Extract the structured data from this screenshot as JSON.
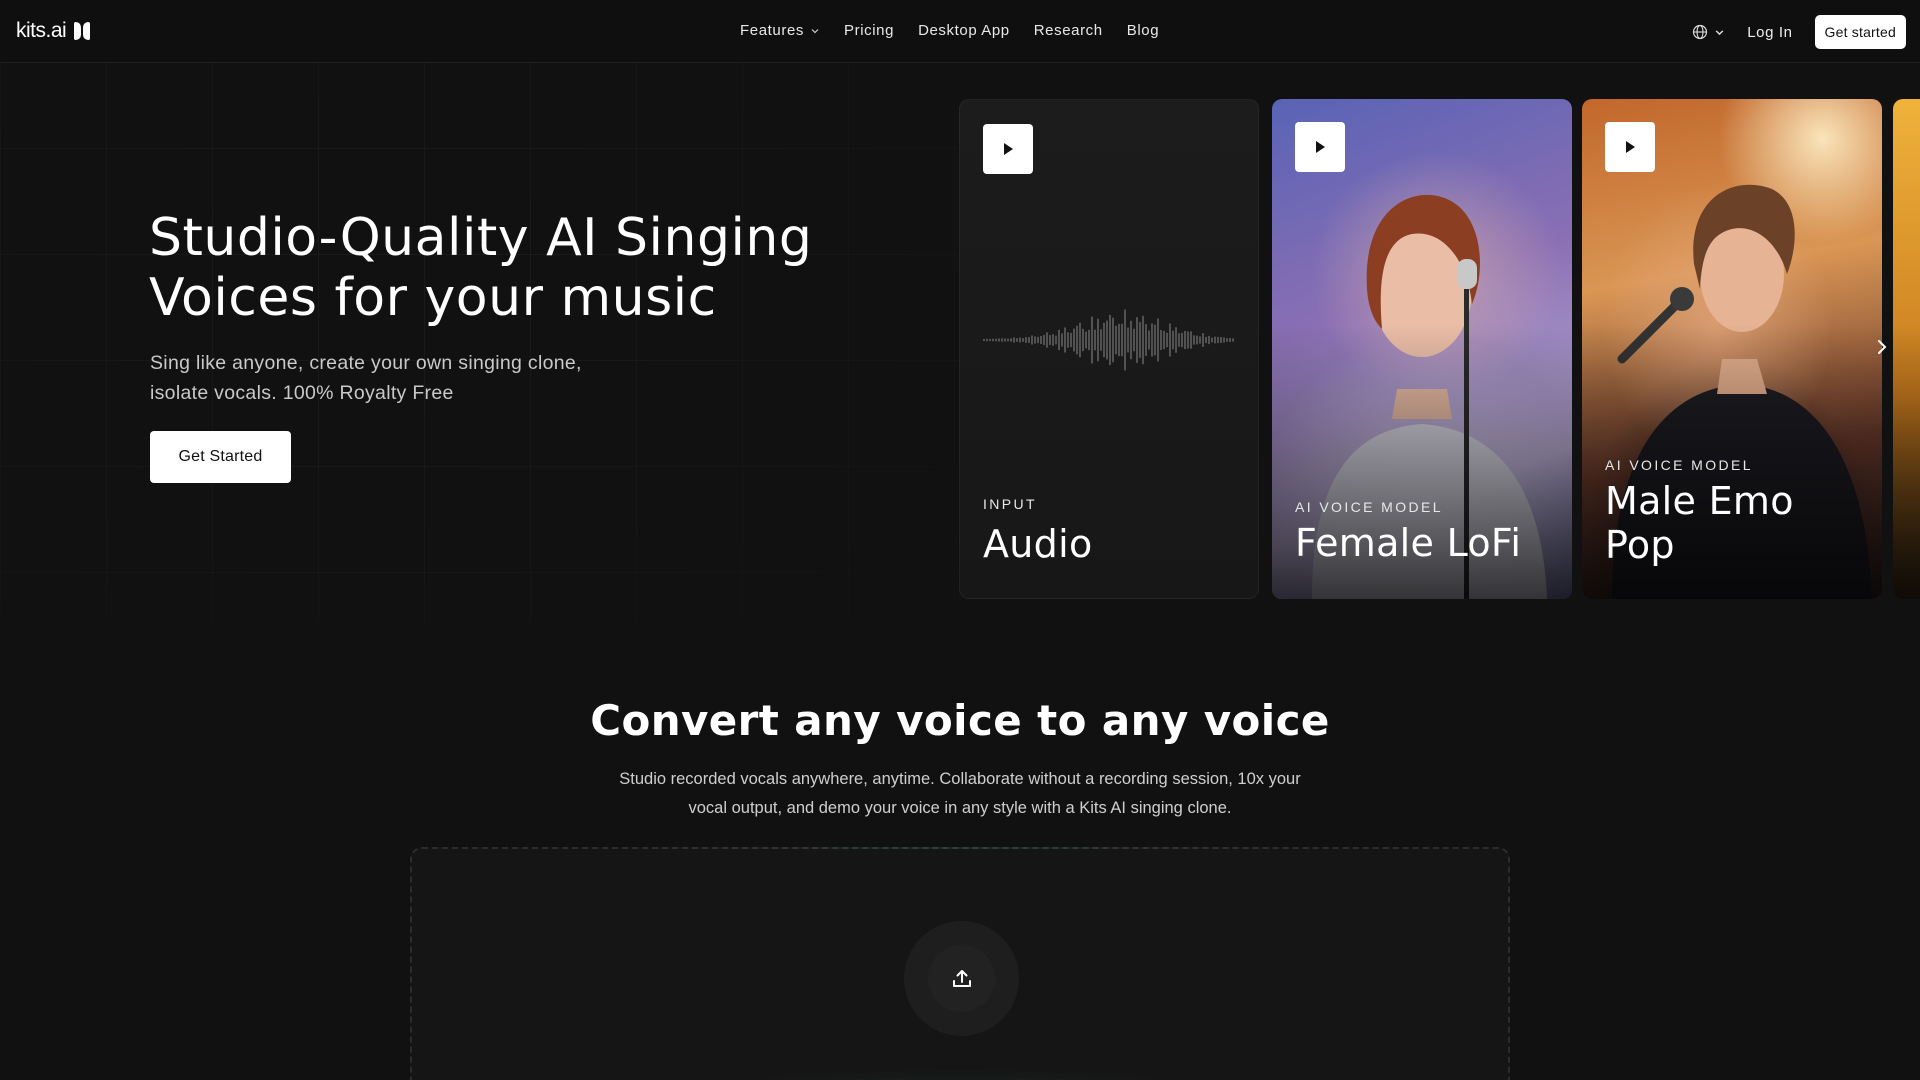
{
  "nav": {
    "logo_text": "kits.ai",
    "links": [
      {
        "label": "Features",
        "has_dropdown": true
      },
      {
        "label": "Pricing"
      },
      {
        "label": "Desktop App"
      },
      {
        "label": "Research"
      },
      {
        "label": "Blog"
      }
    ],
    "language_icon": "globe-icon",
    "login_label": "Log In",
    "cta_label": "Get started"
  },
  "hero": {
    "title_line1": "Studio-Quality AI Singing",
    "title_line2": "Voices for your music",
    "subtitle_line1": "Sing like anyone, create your own singing clone,",
    "subtitle_line2": "isolate vocals. 100% Royalty Free",
    "cta_label": "Get Started"
  },
  "cards": [
    {
      "eyebrow": "INPUT",
      "title": "Audio"
    },
    {
      "eyebrow": "AI VOICE MODEL",
      "title": "Female LoFi"
    },
    {
      "eyebrow": "AI VOICE MODEL",
      "title_line1": "Male Emo",
      "title_line2": "Pop"
    }
  ],
  "convert": {
    "title": "Convert any voice to any voice",
    "desc_line1": "Studio recorded vocals anywhere, anytime. Collaborate without a recording session, 10x your",
    "desc_line2": "vocal output, and demo your voice in any style with a Kits AI singing clone."
  },
  "colors": {
    "background": "#111111",
    "button_bg": "#ffffff",
    "button_text": "#111111"
  }
}
